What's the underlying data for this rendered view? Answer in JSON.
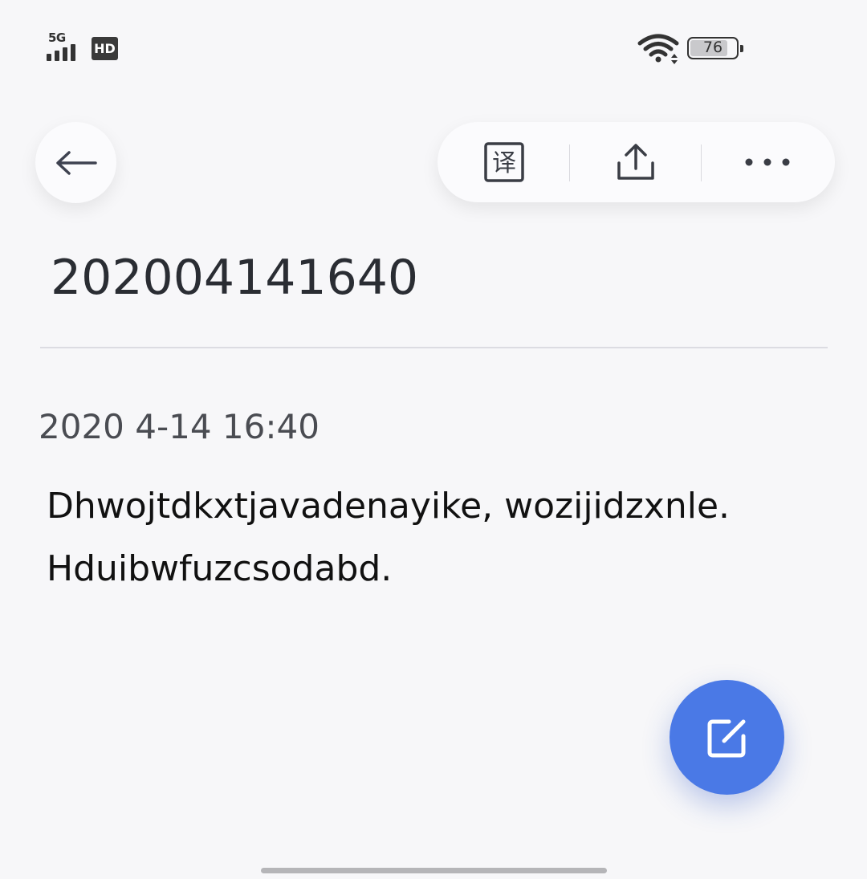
{
  "status_bar": {
    "network_label": "5G",
    "hd_label": "HD",
    "battery_level": "76",
    "icons": [
      "signal-icon",
      "hd-icon",
      "wifi-icon",
      "battery-icon"
    ]
  },
  "toolbar": {
    "back_icon": "arrow-left-icon",
    "translate_glyph": "译",
    "translate_icon": "translate-icon",
    "share_icon": "share-icon",
    "more_icon": "more-horizontal-icon"
  },
  "note": {
    "title": "202004141640",
    "timestamp": "2020 4-14 16:40",
    "body_lines": [
      "Dhwojtdkxtjavadenayike, wozijidzxnle.",
      "Hduibwfuzcsodabd."
    ]
  },
  "fab": {
    "icon": "edit-icon"
  },
  "colors": {
    "background": "#f7f7f9",
    "fab": "#4a79e6",
    "text": "#111111",
    "title": "#2a2d33"
  }
}
